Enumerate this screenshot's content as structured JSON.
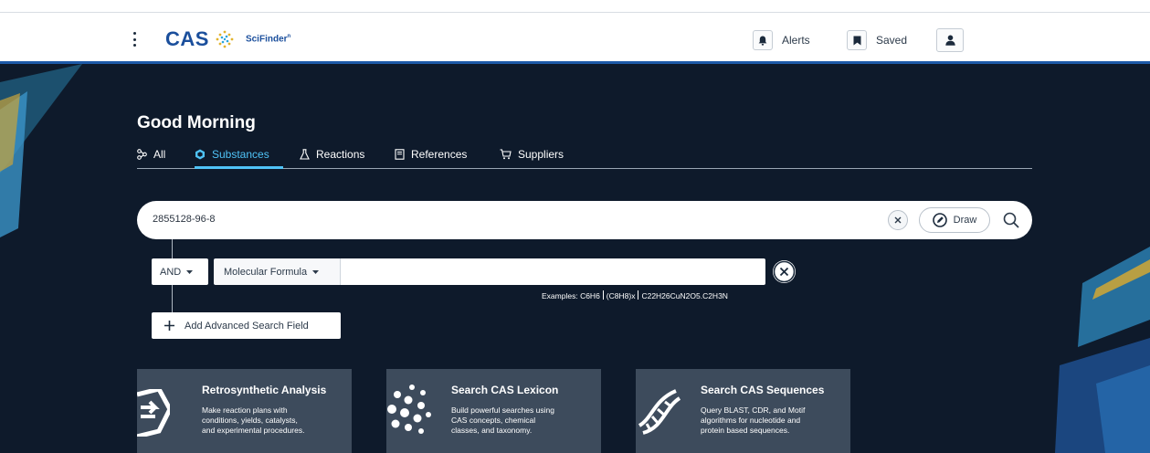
{
  "header": {
    "logo_text": "CAS",
    "product_name": "SciFinder",
    "product_sup": "n",
    "alerts_label": "Alerts",
    "saved_label": "Saved"
  },
  "greeting": "Good Morning",
  "tabs": [
    {
      "label": "All",
      "icon": "hierarchy-icon"
    },
    {
      "label": "Substances",
      "icon": "substance-icon",
      "active": true
    },
    {
      "label": "Reactions",
      "icon": "flask-icon"
    },
    {
      "label": "References",
      "icon": "document-icon"
    },
    {
      "label": "Suppliers",
      "icon": "cart-icon"
    }
  ],
  "search": {
    "value": "2855128-96-8",
    "draw_label": "Draw"
  },
  "advanced": {
    "operator": "AND",
    "field": "Molecular Formula",
    "input_value": "",
    "examples_label": "Examples:",
    "examples": [
      "C6H6",
      "(C8H8)x",
      "C22H26CuN2O5.C2H3N"
    ],
    "add_field_label": "Add Advanced Search Field"
  },
  "cards": [
    {
      "title": "Retrosynthetic Analysis",
      "desc": [
        "Make reaction plans with",
        "conditions, yields, catalysts,",
        "and experimental procedures."
      ],
      "icon": "retrosynthesis-icon"
    },
    {
      "title": "Search CAS Lexicon",
      "desc": [
        "Build powerful searches using",
        "CAS concepts, chemical",
        "classes, and taxonomy."
      ],
      "icon": "lexicon-dots-icon"
    },
    {
      "title": "Search CAS Sequences",
      "desc": [
        "Query BLAST, CDR, and Motif",
        "algorithms for nucleotide and",
        "protein based sequences."
      ],
      "icon": "dna-icon"
    }
  ],
  "colors": {
    "brand_blue": "#1b4f9c",
    "accent_cyan": "#4fc3f7",
    "background": "#0e1a2b",
    "card": "#3d4b5c"
  }
}
